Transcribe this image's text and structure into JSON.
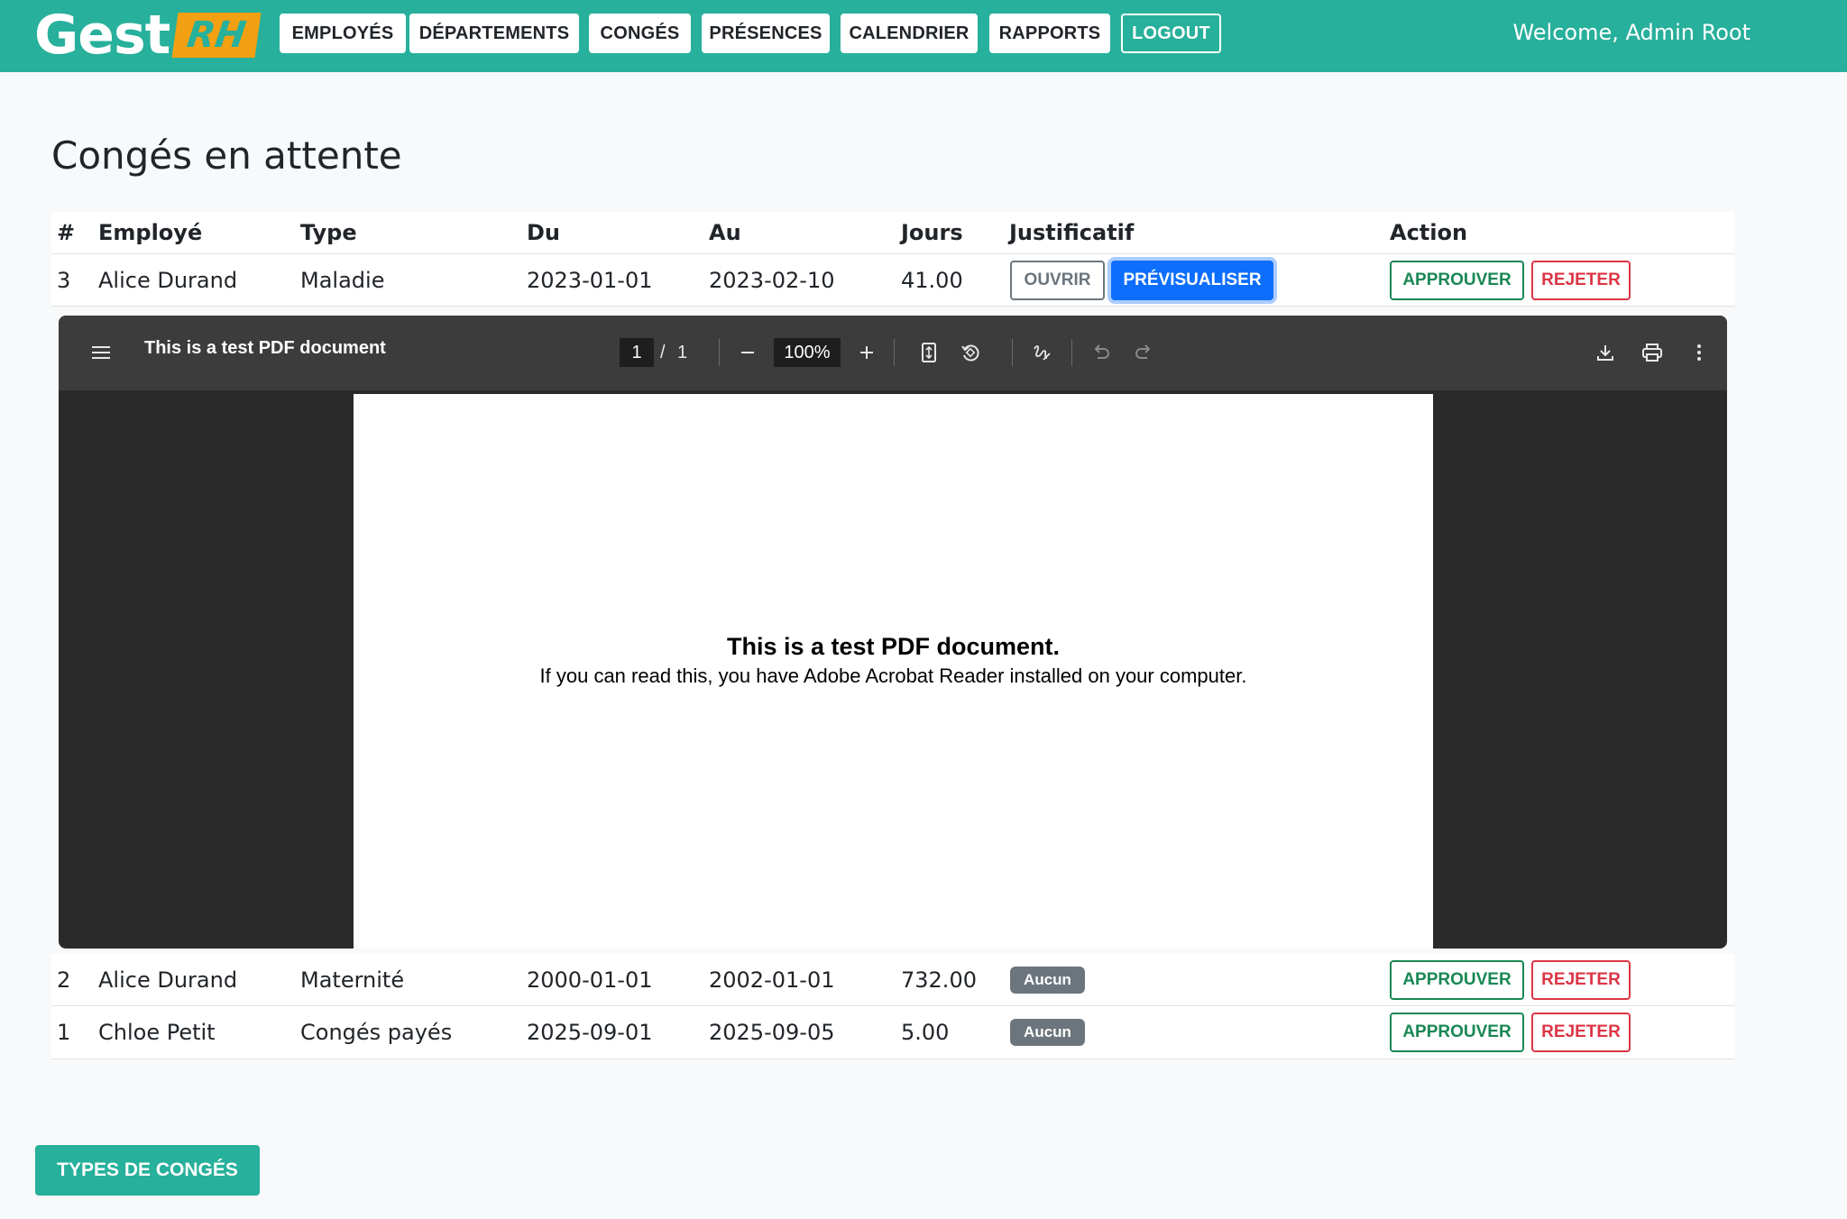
{
  "navbar": {
    "logo_main": "Gest",
    "logo_accent": "RH",
    "items": [
      {
        "label": "EMPLOYÉS"
      },
      {
        "label": "DÉPARTEMENTS"
      },
      {
        "label": "CONGÉS"
      },
      {
        "label": "PRÉSENCES"
      },
      {
        "label": "CALENDRIER"
      },
      {
        "label": "RAPPORTS"
      }
    ],
    "logout_label": "LOGOUT",
    "welcome": "Welcome, Admin Root"
  },
  "page": {
    "title": "Congés en attente"
  },
  "table": {
    "headers": [
      "#",
      "Employé",
      "Type",
      "Du",
      "Au",
      "Jours",
      "Justificatif",
      "Action"
    ],
    "rows": [
      {
        "id": "3",
        "employee": "Alice Durand",
        "type": "Maladie",
        "from": "2023-01-01",
        "to": "2023-02-10",
        "days": "41.00",
        "justif_open": "OUVRIR",
        "justif_preview": "PRÉVISUALISER",
        "approve": "APPROUVER",
        "reject": "REJETER"
      },
      {
        "id": "2",
        "employee": "Alice Durand",
        "type": "Maternité",
        "from": "2000-01-01",
        "to": "2002-01-01",
        "days": "732.00",
        "justif_badge": "Aucun",
        "approve": "APPROUVER",
        "reject": "REJETER"
      },
      {
        "id": "1",
        "employee": "Chloe Petit",
        "type": "Congés payés",
        "from": "2025-09-01",
        "to": "2025-09-05",
        "days": "5.00",
        "justif_badge": "Aucun",
        "approve": "APPROUVER",
        "reject": "REJETER"
      }
    ]
  },
  "pdf_viewer": {
    "title": "This is a test PDF document",
    "page_current": "1",
    "page_separator": "/",
    "page_total": "1",
    "zoom": "100%",
    "doc_heading": "This is a test PDF document.",
    "doc_text": "If you can read this, you have Adobe Acrobat Reader installed on your computer.",
    "icons": [
      "menu-icon",
      "zoom-out-icon",
      "zoom-in-icon",
      "fit-page-icon",
      "rotate-icon",
      "annotate-icon",
      "undo-icon",
      "redo-icon",
      "download-icon",
      "print-icon",
      "more-options-icon"
    ]
  },
  "footer": {
    "types_button": "TYPES DE CONGÉS"
  },
  "colors": {
    "brand": "#27b09b",
    "accent": "#f3a012",
    "primary": "#0d6efd",
    "success": "#198754",
    "danger": "#dc3545",
    "secondary": "#6c757d"
  }
}
